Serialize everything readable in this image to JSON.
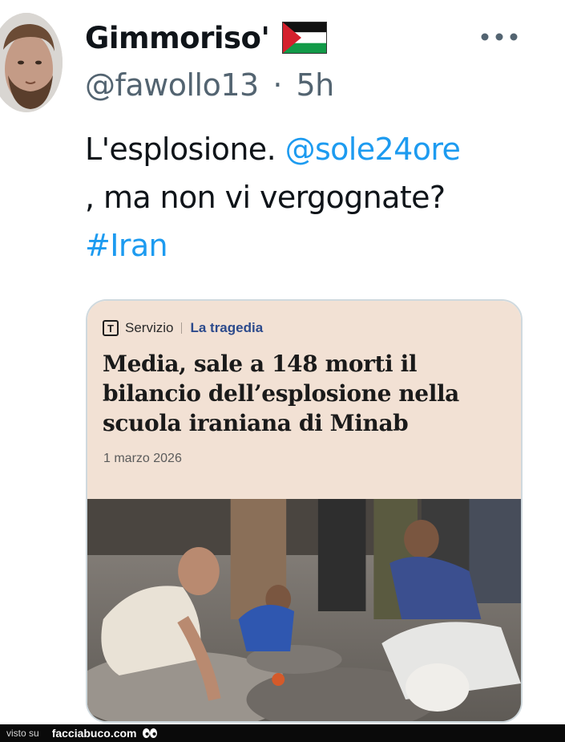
{
  "tweet": {
    "author": {
      "display_name": "Gimmoriso'",
      "flag_icon": "palestine-flag-icon",
      "handle": "@fawollo13",
      "separator": "·",
      "time": "5h"
    },
    "more_icon": "more-horizontal-icon",
    "text": {
      "line1_text": "L'esplosione. ",
      "line1_mention": "@sole24ore",
      "line2_text": ", ma non vi vergognate?",
      "line3_hashtag": "#Iran"
    },
    "media_card": {
      "kicker_icon_letter": "T",
      "kicker_type": "Servizio",
      "kicker_section": "La tragedia",
      "headline": [
        "Media, sale a 148 morti il",
        "bilancio dell’esplosione nella",
        "scuola iraniana di Minab"
      ],
      "date": "1 marzo 2026"
    }
  },
  "footer": {
    "prefix": "visto su",
    "site": "facciabuco.com",
    "logo_icon": "eyes-icon"
  },
  "colors": {
    "link": "#1d9bf0",
    "muted": "#536471",
    "card_header_bg": "#f2e1d4",
    "kicker_section": "#2c4a8c",
    "footer_bg": "#0a0a0a"
  }
}
